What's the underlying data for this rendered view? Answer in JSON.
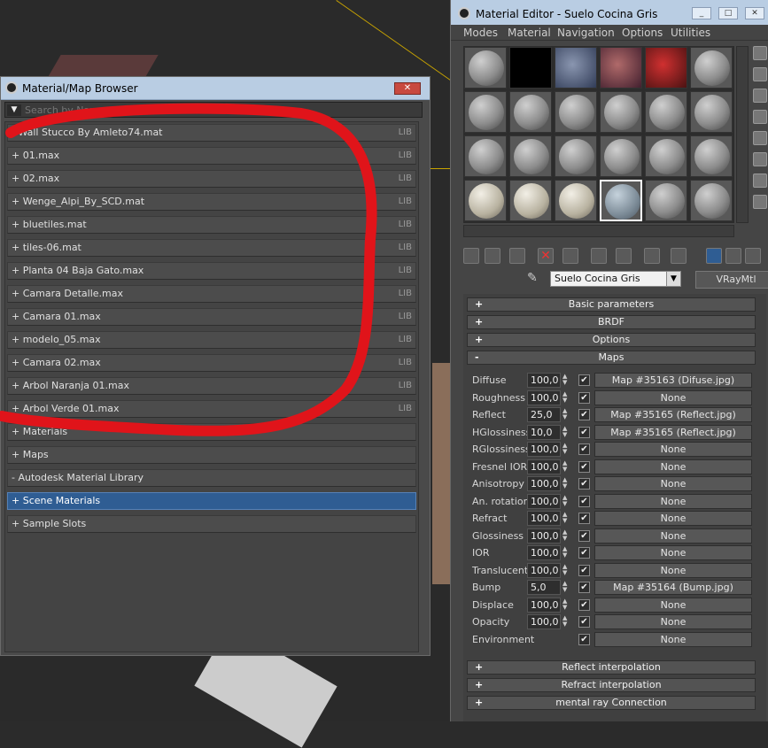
{
  "browser": {
    "title": "Material/Map Browser",
    "close_label": "✕",
    "search_placeholder": "Search by Name ...",
    "items": [
      {
        "label": "- Wall Stucco By Amleto74.mat",
        "tag": "LIB"
      },
      {
        "label": "+ 01.max",
        "tag": "LIB"
      },
      {
        "label": "+ 02.max",
        "tag": "LIB"
      },
      {
        "label": "+ Wenge_Alpi_By_SCD.mat",
        "tag": "LIB"
      },
      {
        "label": "+ bluetiles.mat",
        "tag": "LIB"
      },
      {
        "label": "+ tiles-06.mat",
        "tag": "LIB"
      },
      {
        "label": "+ Planta 04 Baja Gato.max",
        "tag": "LIB"
      },
      {
        "label": "+ Camara Detalle.max",
        "tag": "LIB"
      },
      {
        "label": "+ Camara 01.max",
        "tag": "LIB"
      },
      {
        "label": "+ modelo_05.max",
        "tag": "LIB"
      },
      {
        "label": "+ Camara 02.max",
        "tag": "LIB"
      },
      {
        "label": "+ Arbol Naranja 01.max",
        "tag": "LIB"
      },
      {
        "label": "+ Arbol Verde 01.max",
        "tag": "LIB"
      },
      {
        "label": "+ Materials",
        "tag": ""
      },
      {
        "label": "+ Maps",
        "tag": ""
      },
      {
        "label": "- Autodesk Material Library",
        "tag": ""
      },
      {
        "label": "+ Scene Materials",
        "tag": "",
        "selected": true
      },
      {
        "label": "+ Sample Slots",
        "tag": ""
      }
    ]
  },
  "editor": {
    "title": "Material Editor - Suelo Cocina Gris",
    "menu": [
      "Modes",
      "Material",
      "Navigation",
      "Options",
      "Utilities"
    ],
    "material_name": "Suelo Cocina Gris",
    "material_type": "VRayMtl",
    "rollouts_top": [
      {
        "sign": "+",
        "label": "Basic parameters"
      },
      {
        "sign": "+",
        "label": "BRDF"
      },
      {
        "sign": "+",
        "label": "Options"
      },
      {
        "sign": "-",
        "label": "Maps"
      }
    ],
    "maps": [
      {
        "label": "Diffuse",
        "value": "100,0",
        "checked": true,
        "map": "Map #35163 (Difuse.jpg)"
      },
      {
        "label": "Roughness",
        "value": "100,0",
        "checked": true,
        "map": "None"
      },
      {
        "label": "Reflect",
        "value": "25,0",
        "checked": true,
        "map": "Map #35165 (Reflect.jpg)"
      },
      {
        "label": "HGlossiness",
        "value": "10,0",
        "checked": true,
        "map": "Map #35165 (Reflect.jpg)"
      },
      {
        "label": "RGlossiness",
        "value": "100,0",
        "checked": true,
        "map": "None"
      },
      {
        "label": "Fresnel IOR",
        "value": "100,0",
        "checked": true,
        "map": "None"
      },
      {
        "label": "Anisotropy",
        "value": "100,0",
        "checked": true,
        "map": "None"
      },
      {
        "label": "An. rotation",
        "value": "100,0",
        "checked": true,
        "map": "None"
      },
      {
        "label": "Refract",
        "value": "100,0",
        "checked": true,
        "map": "None"
      },
      {
        "label": "Glossiness",
        "value": "100,0",
        "checked": true,
        "map": "None"
      },
      {
        "label": "IOR",
        "value": "100,0",
        "checked": true,
        "map": "None"
      },
      {
        "label": "Translucent",
        "value": "100,0",
        "checked": true,
        "map": "None"
      },
      {
        "label": "Bump",
        "value": "5,0",
        "checked": true,
        "map": "Map #35164 (Bump.jpg)"
      },
      {
        "label": "Displace",
        "value": "100,0",
        "checked": true,
        "map": "None"
      },
      {
        "label": "Opacity",
        "value": "100,0",
        "checked": true,
        "map": "None"
      },
      {
        "label": "Environment",
        "value": "",
        "checked": true,
        "map": "None"
      }
    ],
    "rollouts_bottom": [
      {
        "sign": "+",
        "label": "Reflect interpolation"
      },
      {
        "sign": "+",
        "label": "Refract interpolation"
      },
      {
        "sign": "+",
        "label": "mental ray Connection"
      }
    ]
  },
  "colors": {
    "highlight": "#2f5d93",
    "titlebar": "#b9cde3",
    "annotation": "#e0141a"
  }
}
